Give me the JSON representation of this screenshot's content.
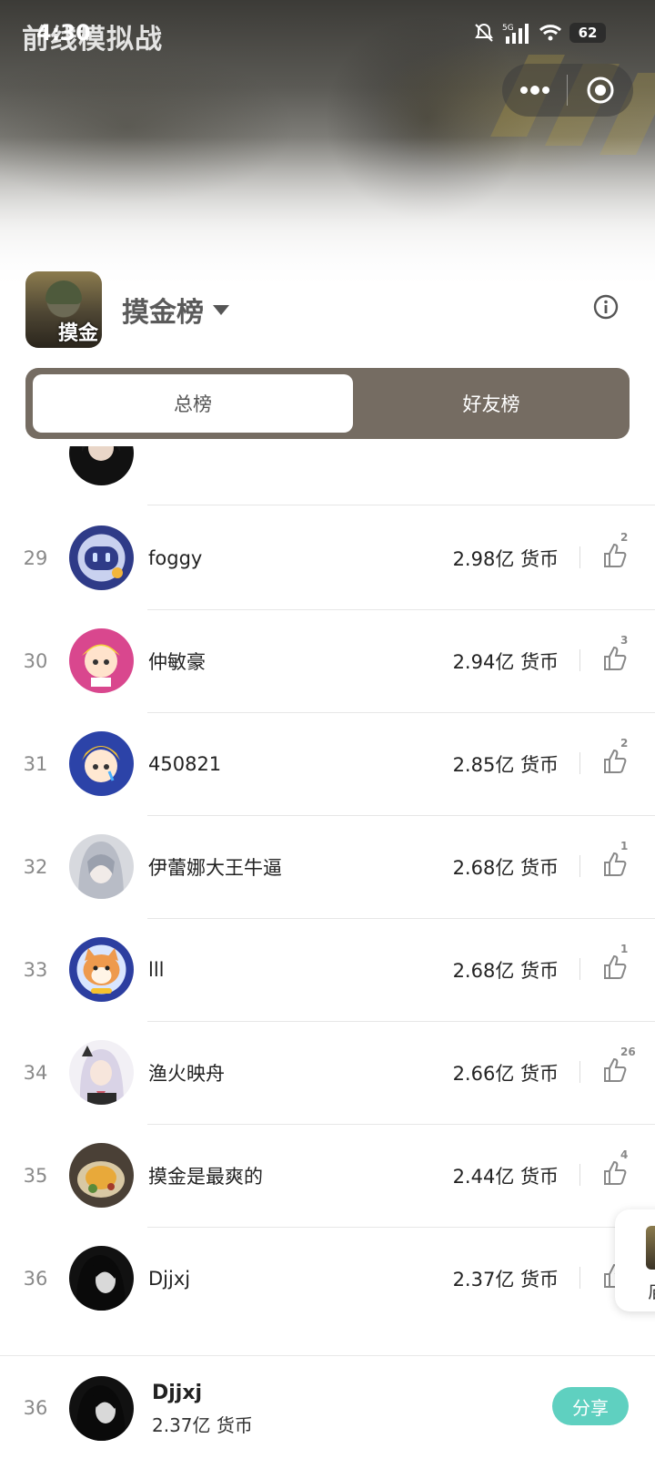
{
  "status_bar": {
    "time": "4:30",
    "battery": "62",
    "network": "5G"
  },
  "app_title": "前线模拟战",
  "header": {
    "board_title": "摸金榜",
    "logo_text": "摸金"
  },
  "tabs": [
    {
      "label": "总榜",
      "active": true
    },
    {
      "label": "好友榜",
      "active": false
    }
  ],
  "leaderboard": [
    {
      "rank": "",
      "name": "",
      "score": "",
      "likes": ""
    },
    {
      "rank": "29",
      "name": "foggy",
      "score": "2.98亿 货币",
      "likes": "2"
    },
    {
      "rank": "30",
      "name": "仲敏豪",
      "score": "2.94亿 货币",
      "likes": "3"
    },
    {
      "rank": "31",
      "name": "450821",
      "score": "2.85亿 货币",
      "likes": "2"
    },
    {
      "rank": "32",
      "name": "伊蕾娜大王牛逼",
      "score": "2.68亿 货币",
      "likes": "1"
    },
    {
      "rank": "33",
      "name": "lll",
      "score": "2.68亿 货币",
      "likes": "1"
    },
    {
      "rank": "34",
      "name": "渔火映舟",
      "score": "2.66亿 货币",
      "likes": "26"
    },
    {
      "rank": "35",
      "name": "摸金是最爽的",
      "score": "2.44亿 货币",
      "likes": "4"
    },
    {
      "rank": "36",
      "name": "Djjxj",
      "score": "2.37亿 货币",
      "likes": ""
    }
  ],
  "side_card": {
    "text": "庙"
  },
  "my_rank": {
    "rank": "36",
    "name": "Djjxj",
    "score": "2.37亿 货币",
    "share_label": "分享"
  },
  "colors": {
    "tab_bar": "#756c62",
    "share": "#5fd0c0",
    "rank_text": "#8a8a8a"
  }
}
